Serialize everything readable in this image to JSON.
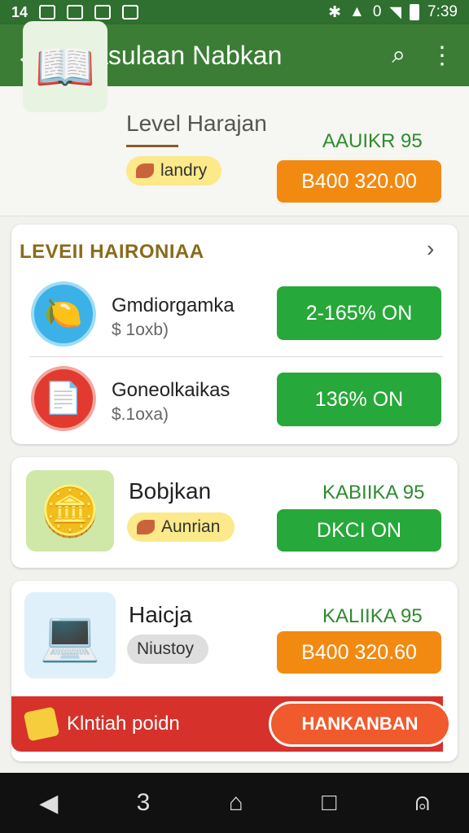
{
  "status_bar": {
    "left_icons": [
      "14",
      "glyph",
      "photo",
      "download",
      "image"
    ],
    "time": "7:39",
    "signal_text": "0"
  },
  "app_bar": {
    "title": "Casulaan Nabkan",
    "back_icon": "arrow-left-icon",
    "search_icon": "search-icon",
    "menu_icon": "more-vertical-icon"
  },
  "top_card": {
    "title": "Level Harajan",
    "chip": "landry",
    "label": "AAUIKR 95",
    "button": "B400 320.00"
  },
  "section": {
    "header": "LEVEII HAIRONIAA",
    "items": [
      {
        "name": "Gmdiorgamka",
        "sub": "$ 1oxb)",
        "button": "2-165% ON"
      },
      {
        "name": "Goneolkaikas",
        "sub": "$.1oxa)",
        "button": "136% ON"
      }
    ]
  },
  "card_bobjkan": {
    "name": "Bobjkan",
    "chip": "Aunrian",
    "label": "KABIIKA 95",
    "button": "DKCI ON"
  },
  "card_haicja": {
    "name": "Haicja",
    "chip": "Niustoy",
    "label": "KALIIKA 95",
    "button": "B400 320.60"
  },
  "banner": {
    "text": "Klntiah poidn",
    "cta": "HANKANBAN"
  },
  "nav_bar": {
    "icons": [
      "back-triangle-icon",
      "recents-3-icon",
      "home-icon",
      "overview-square-icon",
      "account-icon"
    ]
  }
}
